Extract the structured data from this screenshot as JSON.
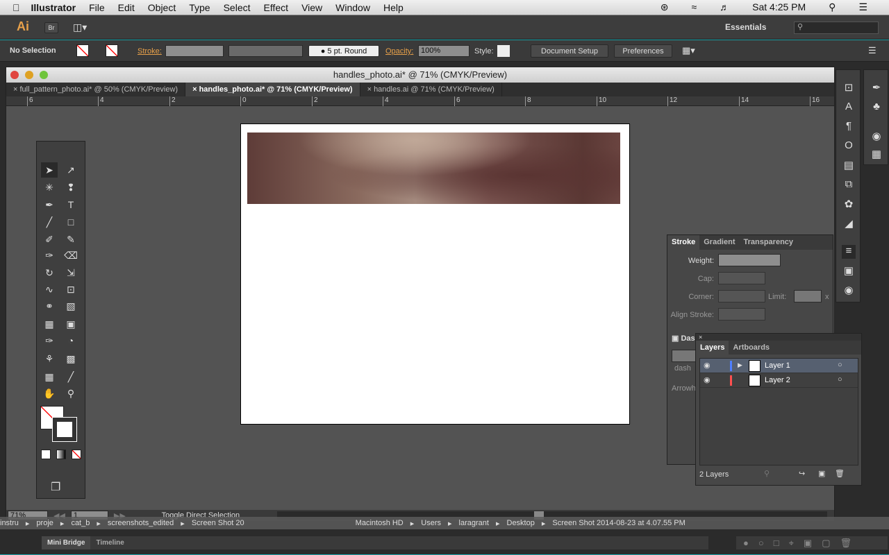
{
  "menubar": {
    "app": "Illustrator",
    "items": [
      "File",
      "Edit",
      "Object",
      "Type",
      "Select",
      "Effect",
      "View",
      "Window",
      "Help"
    ],
    "clock": "Sat 4:25 PM"
  },
  "appbar": {
    "logo": "Ai",
    "bridge": "Br",
    "workspace": "Essentials"
  },
  "control": {
    "selection": "No Selection",
    "stroke_label": "Stroke:",
    "brush": "5 pt. Round",
    "opacity_label": "Opacity:",
    "opacity": "100%",
    "style_label": "Style:",
    "document_setup": "Document Setup",
    "preferences": "Preferences"
  },
  "document": {
    "title": "handles_photo.ai* @ 71% (CMYK/Preview)",
    "tabs": [
      {
        "label": "full_pattern_photo.ai* @ 50% (CMYK/Preview)",
        "active": false
      },
      {
        "label": "handles_photo.ai* @ 71% (CMYK/Preview)",
        "active": true
      },
      {
        "label": "handles.ai @ 71% (CMYK/Preview)",
        "active": false
      }
    ],
    "ruler": [
      "6",
      "4",
      "2",
      "0",
      "2",
      "4",
      "6",
      "8",
      "10",
      "12",
      "14",
      "16"
    ],
    "zoom": "71%",
    "artboard": "1",
    "status": "Toggle Direct Selection"
  },
  "stroke_panel": {
    "tabs": [
      "Stroke",
      "Gradient",
      "Transparency"
    ],
    "weight": "Weight:",
    "cap": "Cap:",
    "corner": "Corner:",
    "limit": "Limit:",
    "limit_unit": "x",
    "align": "Align Stroke:",
    "dashed": "Das",
    "dash": "dash",
    "arrow": "Arrowh"
  },
  "layers_panel": {
    "tabs": [
      "Layers",
      "Artboards"
    ],
    "layers": [
      {
        "name": "Layer 1",
        "color": "#4f7fff",
        "selected": true
      },
      {
        "name": "Layer 2",
        "color": "#ff4f4f",
        "selected": false
      }
    ],
    "count": "2 Layers"
  },
  "finder": {
    "left": [
      "instru",
      "proje",
      "cat_b",
      "screenshots_edited",
      "Screen Shot 20"
    ],
    "right": [
      "Macintosh HD",
      "Users",
      "laragrant",
      "Desktop",
      "Screen Shot 2014-08-23 at 4.07.55 PM"
    ]
  },
  "bottom": {
    "tabs": [
      "Mini Bridge",
      "Timeline"
    ]
  }
}
